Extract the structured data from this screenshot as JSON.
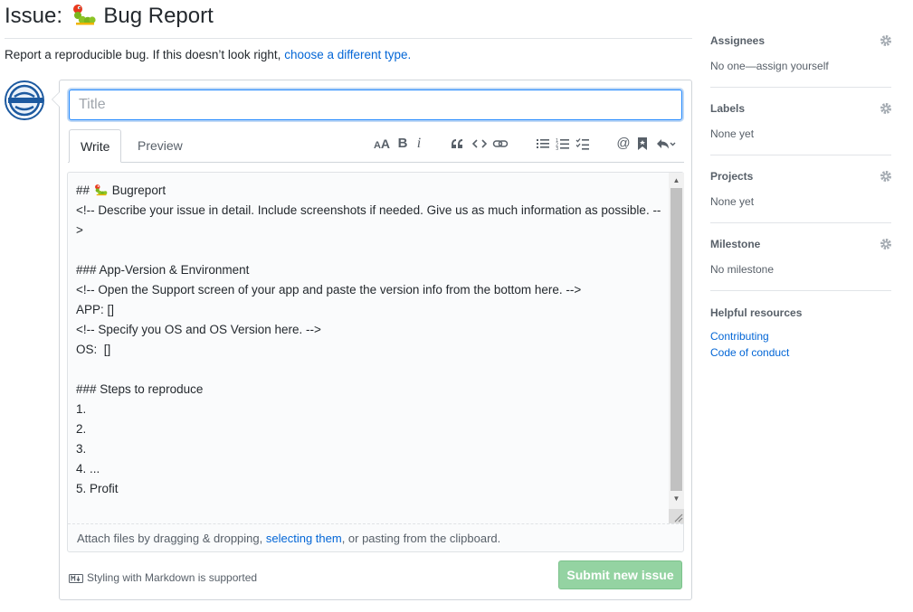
{
  "header": {
    "title_prefix": "Issue:",
    "title_text": "Bug Report",
    "subtitle_text": "Report a reproducible bug. If this doesn’t look right,",
    "subtitle_link": "choose a different type."
  },
  "form": {
    "title_placeholder": "Title",
    "tabs": [
      {
        "label": "Write",
        "active": true
      },
      {
        "label": "Preview",
        "active": false
      }
    ],
    "toolbar": [
      "header-icon",
      "bold-icon",
      "italic-icon",
      "quote-icon",
      "code-icon",
      "link-icon",
      "bulleted-list-icon",
      "numbered-list-icon",
      "task-list-icon",
      "mention-icon",
      "saved-reply-icon",
      "reply-icon"
    ],
    "editor_lines": [
      {
        "prefix": "## ",
        "has_bug": true,
        "text": "Bugreport"
      },
      {
        "prefix": "",
        "has_bug": false,
        "text": "<!-- Describe your issue in detail. Include screenshots if needed. Give us as much information as possible. -->"
      },
      {
        "prefix": "",
        "has_bug": false,
        "text": ""
      },
      {
        "prefix": "",
        "has_bug": false,
        "text": "### App-Version & Environment"
      },
      {
        "prefix": "",
        "has_bug": false,
        "text": "<!-- Open the Support screen of your app and paste the version info from the bottom here. -->"
      },
      {
        "prefix": "",
        "has_bug": false,
        "text": "APP: []"
      },
      {
        "prefix": "",
        "has_bug": false,
        "text": "<!-- Specify you OS and OS Version here. -->"
      },
      {
        "prefix": "",
        "has_bug": false,
        "text": "OS:  []"
      },
      {
        "prefix": "",
        "has_bug": false,
        "text": ""
      },
      {
        "prefix": "",
        "has_bug": false,
        "text": "### Steps to reproduce"
      },
      {
        "prefix": "",
        "has_bug": false,
        "text": "1."
      },
      {
        "prefix": "",
        "has_bug": false,
        "text": "2."
      },
      {
        "prefix": "",
        "has_bug": false,
        "text": "3."
      },
      {
        "prefix": "",
        "has_bug": false,
        "text": "4. ..."
      },
      {
        "prefix": "",
        "has_bug": false,
        "text": "5. Profit"
      }
    ],
    "attach_prefix": "Attach files by dragging & dropping, ",
    "attach_link": "selecting them",
    "attach_suffix": ", or pasting from the clipboard.",
    "markdown_note": "Styling with Markdown is supported",
    "submit_label": "Submit new issue"
  },
  "sidebar": {
    "sections": [
      {
        "heading": "Assignees",
        "value": "No one—assign yourself"
      },
      {
        "heading": "Labels",
        "value": "None yet"
      },
      {
        "heading": "Projects",
        "value": "None yet"
      },
      {
        "heading": "Milestone",
        "value": "No milestone"
      }
    ],
    "helpful": {
      "heading": "Helpful resources",
      "links": [
        "Contributing",
        "Code of conduct"
      ]
    }
  },
  "colors": {
    "link": "#0366d6",
    "submit_disabled": "#94d3a2",
    "focus_border": "#2188ff"
  }
}
